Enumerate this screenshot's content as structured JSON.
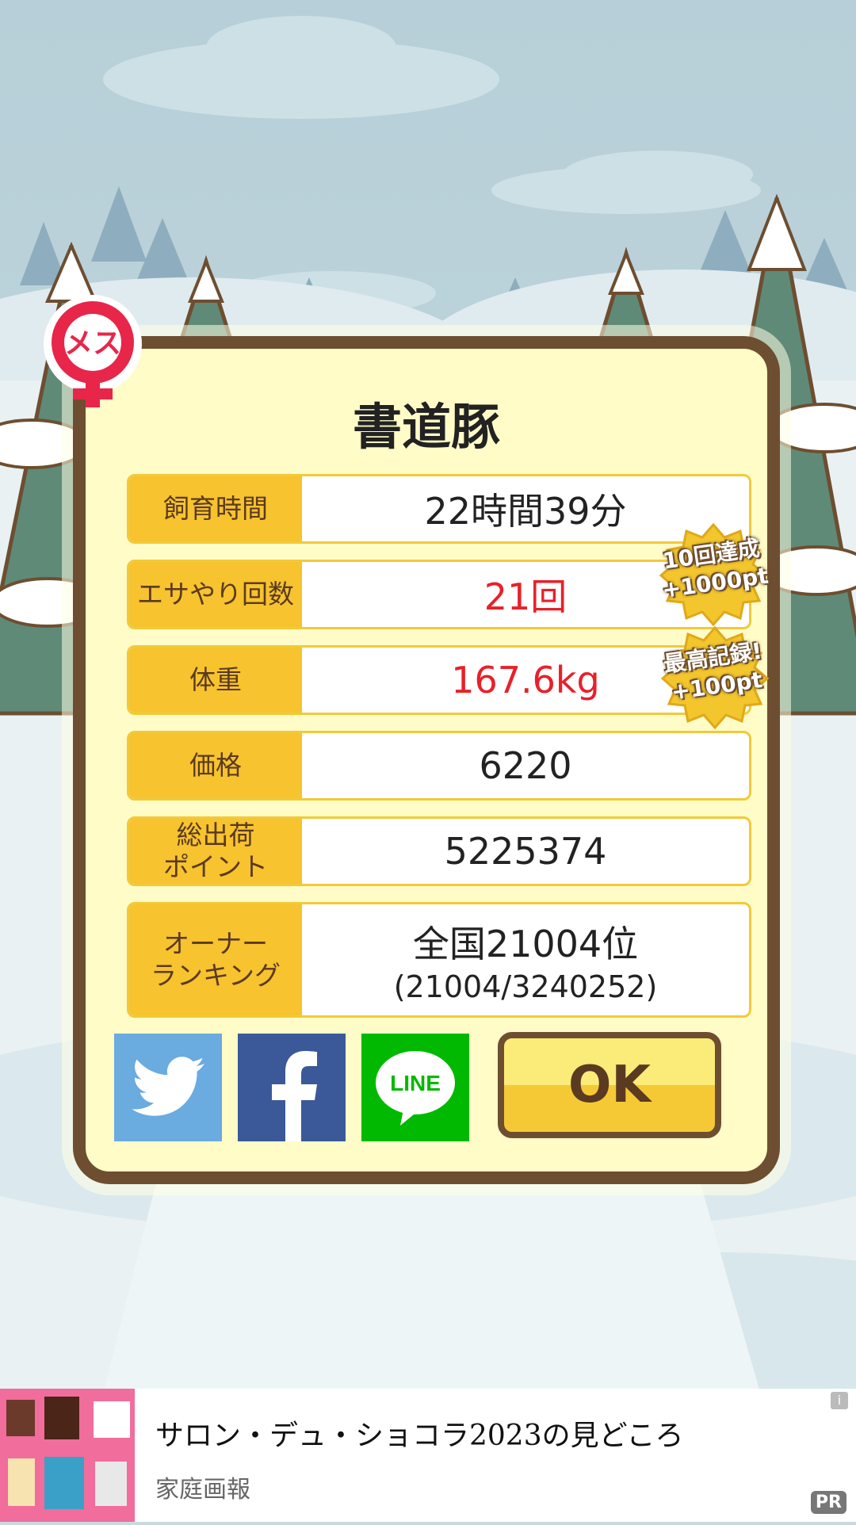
{
  "pig": {
    "name": "書道豚",
    "gender_badge": "メス"
  },
  "stats": {
    "rows": [
      {
        "label": "飼育時間",
        "value": "22時間39分"
      },
      {
        "label": "エサやり回数",
        "value": "21回"
      },
      {
        "label": "体重",
        "value": "167.6kg"
      },
      {
        "label": "価格",
        "value": "6220"
      },
      {
        "label": "総出荷\nポイント",
        "value": "5225374"
      },
      {
        "label": "オーナー\nランキング",
        "value": "全国21004位",
        "sub": "(21004/3240252)"
      }
    ],
    "highlight_color": "#e8202a"
  },
  "badges": [
    {
      "line1": "10回達成",
      "line2": "+1000pt"
    },
    {
      "line1": "最高記録!",
      "line2": "+100pt"
    }
  ],
  "buttons": {
    "ok_label": "OK",
    "twitter_icon": "twitter-bird-icon",
    "facebook_icon": "facebook-f-icon",
    "line_label": "LINE"
  },
  "colors": {
    "twitter": "#6aabe0",
    "facebook": "#3b5998",
    "line": "#00b900",
    "label_bg": "#f7c32e",
    "frame": "#6e4e30"
  },
  "ad": {
    "title": "サロン・デュ・ショコラ2023の見どころ",
    "source": "家庭画報",
    "pr": "PR",
    "info": "i"
  }
}
